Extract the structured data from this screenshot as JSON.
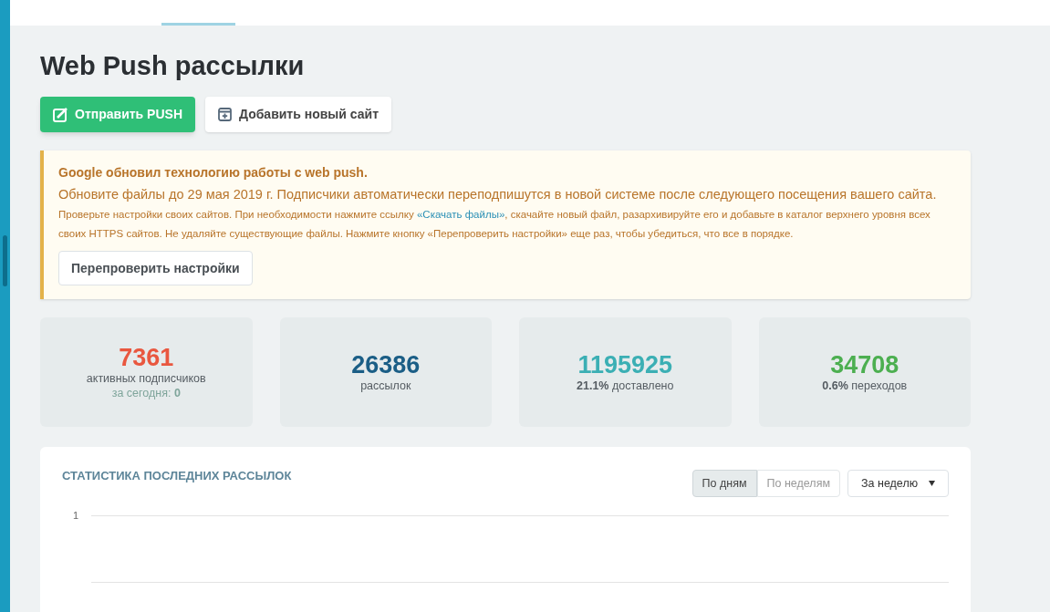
{
  "header": {
    "tabs": [
      {
        "selected": true
      }
    ]
  },
  "title": "Web Push рассылки",
  "actions": [
    {
      "label": "Отправить PUSH",
      "kind": "primary"
    },
    {
      "label": "Добавить новый сайт",
      "kind": "secondary"
    }
  ],
  "alert": {
    "heading": "Google обновил технологию работы с web push.",
    "lead": "Обновите файлы до 29 мая 2019 г. Подписчики автоматически переподпишутся в новой системе после следующего посещения вашего сайта.",
    "text_before": "Проверьте настройки своих сайтов. При необходимости нажмите ссылку",
    "link": "«Скачать файлы»",
    "text_after": ", скачайте новый файл, разархивируйте его и добавьте в каталог верхнего уровня всех своих HTTPS сайтов. Не удаляйте существующие файлы. Нажмите кнопку «Перепроверить настройки» еще раз, чтобы убедиться, что все в порядке.",
    "button": "Перепроверить настройки"
  },
  "stats": [
    {
      "value": "7361",
      "color": "#e9573f",
      "label": "активных подписчиков",
      "sub": "за сегодня: **0**"
    },
    {
      "value": "26386",
      "color": "#1b5e86",
      "label": "рассылок"
    },
    {
      "value": "1195925",
      "color": "#3bafb4",
      "label": "**21.1%** доставлено"
    },
    {
      "value": "34708",
      "color": "#4caf50",
      "label": "**0.6%** переходов"
    }
  ],
  "panel": {
    "title": "СТАТИСТИКА ПОСЛЕДНИХ РАССЫЛОК",
    "toggles": [
      {
        "label": "По дням",
        "selected": true
      },
      {
        "label": "По неделям",
        "selected": false
      }
    ],
    "period": "За неделю",
    "y_tick": "1"
  }
}
